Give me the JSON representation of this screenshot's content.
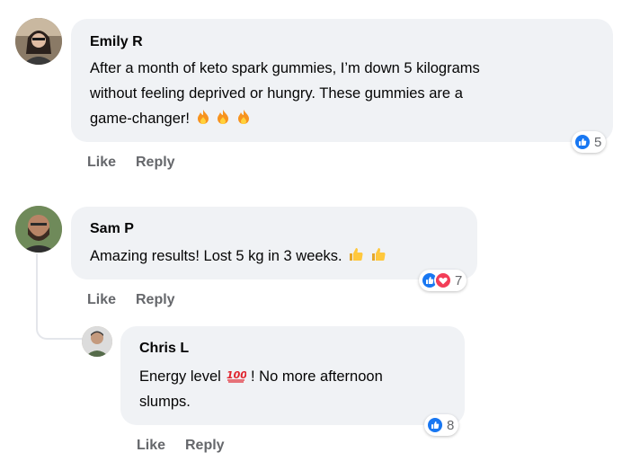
{
  "comments": [
    {
      "author": "Emily R",
      "text_line1": "After a month of keto spark gummies, I’m down 5 kilograms",
      "text_line2": "without feeling deprived or hungry. These gummies are a",
      "text_line3": "game-changer!",
      "emojis": [
        "fire",
        "fire",
        "fire"
      ],
      "reaction_count": "5",
      "like_label": "Like",
      "reply_label": "Reply"
    },
    {
      "author": "Sam P",
      "text_line1": "Amazing results! Lost 5 kg in 3 weeks.",
      "emojis": [
        "thumbs-up",
        "thumbs-up"
      ],
      "reaction_count": "7",
      "like_label": "Like",
      "reply_label": "Reply"
    },
    {
      "author": "Chris L",
      "text_part1": "Energy level",
      "text_part2": "! No more afternoon",
      "text_line2": "slumps.",
      "emojis": [
        "hundred-points"
      ],
      "reaction_count": "8",
      "like_label": "Like",
      "reply_label": "Reply"
    }
  ],
  "colors": {
    "bubble": "#f0f2f5",
    "like_blue": "#1877f2",
    "love_red": "#f33e58",
    "secondary_text": "#65676b"
  }
}
